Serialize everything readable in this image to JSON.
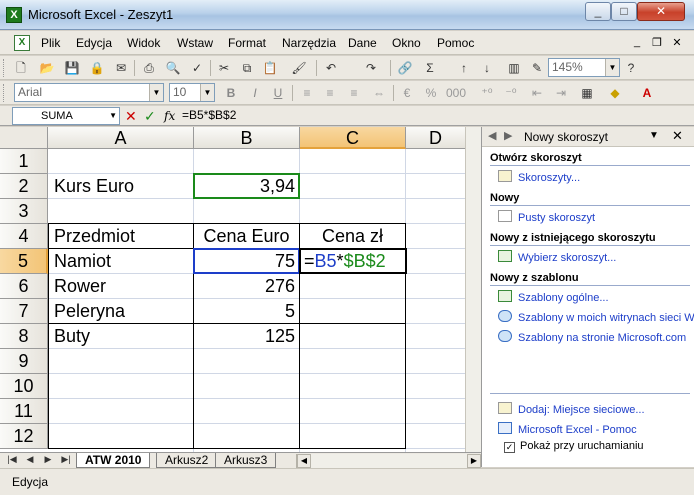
{
  "window": {
    "title": "Microsoft Excel - Zeszyt1"
  },
  "menu": [
    "Plik",
    "Edycja",
    "Widok",
    "Wstaw",
    "Format",
    "Narzędzia",
    "Dane",
    "Okno",
    "Pomoc"
  ],
  "toolbar": {
    "zoom": "145%",
    "font_name": "Arial",
    "font_size": "10",
    "sum_symbol": "Σ"
  },
  "formula_bar": {
    "name_box": "SUMA",
    "formula": "=B5*$B$2"
  },
  "columns": [
    "A",
    "B",
    "C",
    "D"
  ],
  "rows": [
    "1",
    "2",
    "3",
    "4",
    "5",
    "6",
    "7",
    "8",
    "9",
    "10",
    "11",
    "12"
  ],
  "cells": {
    "A2": "Kurs Euro",
    "B2": "3,94",
    "A4": "Przedmiot",
    "B4": "Cena Euro",
    "C4": "Cena zł",
    "A5": "Namiot",
    "B5": "75",
    "A6": "Rower",
    "B6": "276",
    "A7": "Peleryna",
    "B7": "5",
    "A8": "Buty",
    "B8": "125"
  },
  "editing": {
    "eq": "=",
    "ref1": "B5",
    "op": "*",
    "ref2": "$B$2"
  },
  "task_pane": {
    "title": "Nowy skoroszyt",
    "sections": {
      "open": {
        "heading": "Otwórz skoroszyt",
        "links": [
          "Skoroszyty..."
        ]
      },
      "new": {
        "heading": "Nowy",
        "links": [
          "Pusty skoroszyt"
        ]
      },
      "from_existing": {
        "heading": "Nowy z istniejącego skoroszytu",
        "links": [
          "Wybierz skoroszyt..."
        ]
      },
      "from_template": {
        "heading": "Nowy z szablonu",
        "links": [
          "Szablony ogólne...",
          "Szablony w moich witrynach sieci Web...",
          "Szablony na stronie Microsoft.com"
        ]
      }
    },
    "footer_links": [
      "Dodaj: Miejsce sieciowe...",
      "Microsoft Excel - Pomoc"
    ],
    "checkbox_label": "Pokaż przy uruchamianiu"
  },
  "sheet_tabs": [
    "ATW 2010",
    "Arkusz2",
    "Arkusz3"
  ],
  "status": "Edycja"
}
